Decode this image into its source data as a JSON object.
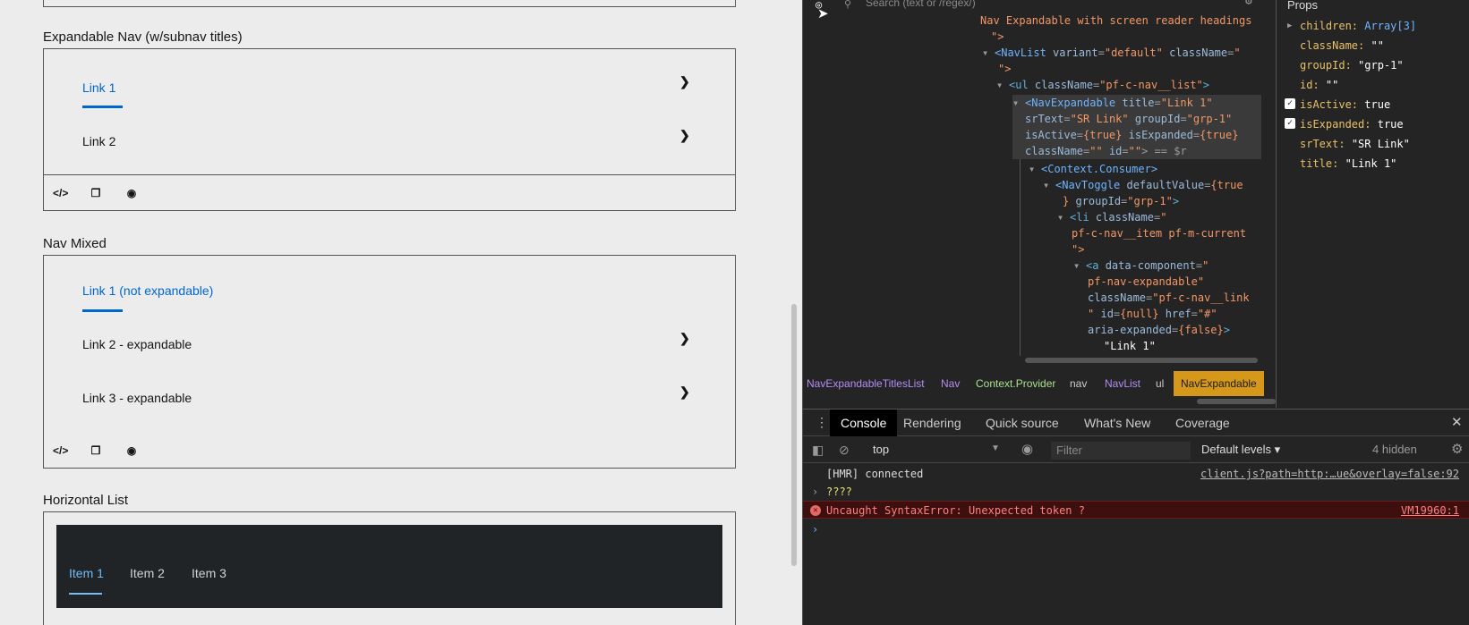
{
  "left": {
    "sections": [
      {
        "title": "Expandable Nav (w/subnav titles)",
        "links": [
          "Link 1",
          "Link 2"
        ]
      },
      {
        "title": "Nav Mixed",
        "links": [
          "Link 1 (not expandable)",
          "Link 2 - expandable",
          "Link 3 - expandable"
        ]
      },
      {
        "title": "Horizontal List",
        "items": [
          "Item 1",
          "Item 2",
          "Item 3"
        ]
      }
    ],
    "chevron": "›",
    "toolbar_icons": [
      "code-icon",
      "copy-icon",
      "github-icon"
    ]
  },
  "devtools": {
    "search_placeholder": "Search (text or /regex/)",
    "tree": [
      "Nav Expandable with screen reader headings",
      "\">",
      "<NavList",
      "variant",
      "\"default\"",
      "className",
      "\"",
      "\">",
      "<ul",
      "className",
      "\"pf-c-nav__list\"",
      ">",
      "<NavExpandable",
      "title",
      "\"Link 1\"",
      "srText",
      "\"SR Link\"",
      "groupId",
      "\"grp-1\"",
      "isActive",
      "{true}",
      "isExpanded",
      "{true}",
      "className",
      "\"\"",
      "id",
      "\"\"",
      "> == $r",
      "<Context.Consumer>",
      "<NavToggle",
      "defaultValue",
      "{true",
      "}",
      "groupId",
      "\"grp-1\"",
      "<li",
      "className",
      "\"",
      "pf-c-nav__item pf-m-current",
      "\">",
      "<a",
      "data-component",
      "\"",
      "pf-nav-expandable\"",
      "className",
      "\"pf-c-nav__link",
      "\"",
      "id",
      "{null}",
      "href",
      "\"#\"",
      "aria-expanded",
      "{false}",
      "\"Link 1\""
    ],
    "breadcrumbs": [
      "NavExpandableTitlesList",
      "Nav",
      "Context.Provider",
      "nav",
      "NavList",
      "ul",
      "NavExpandable"
    ],
    "props": {
      "title": "Props",
      "rows": [
        {
          "key": "children:",
          "value": "Array[3]"
        },
        {
          "key": "className:",
          "value": "\"\""
        },
        {
          "key": "groupId:",
          "value": "\"grp-1\""
        },
        {
          "key": "id:",
          "value": "\"\""
        },
        {
          "key": "isActive:",
          "value": "true"
        },
        {
          "key": "isExpanded:",
          "value": "true"
        },
        {
          "key": "srText:",
          "value": "\"SR Link\""
        },
        {
          "key": "title:",
          "value": "\"Link 1\""
        }
      ]
    },
    "drawer": {
      "tabs": [
        "Console",
        "Rendering",
        "Quick source",
        "What's New",
        "Coverage"
      ],
      "context": "top",
      "filter_placeholder": "Filter",
      "levels": "Default levels ▾",
      "hidden": "4 hidden",
      "lines": [
        {
          "msg": "[HMR] connected",
          "src": "client.js?path=http:…ue&overlay=false:92"
        },
        {
          "msg": "????",
          "src": ""
        },
        {
          "msg": "Uncaught SyntaxError: Unexpected token ?",
          "src": "VM19960:1"
        }
      ]
    }
  },
  "colors": {
    "accent": "#06c",
    "dark_nav": "#212427",
    "error_bg": "#3d0f0f",
    "active_crumb": "#d6981a"
  }
}
